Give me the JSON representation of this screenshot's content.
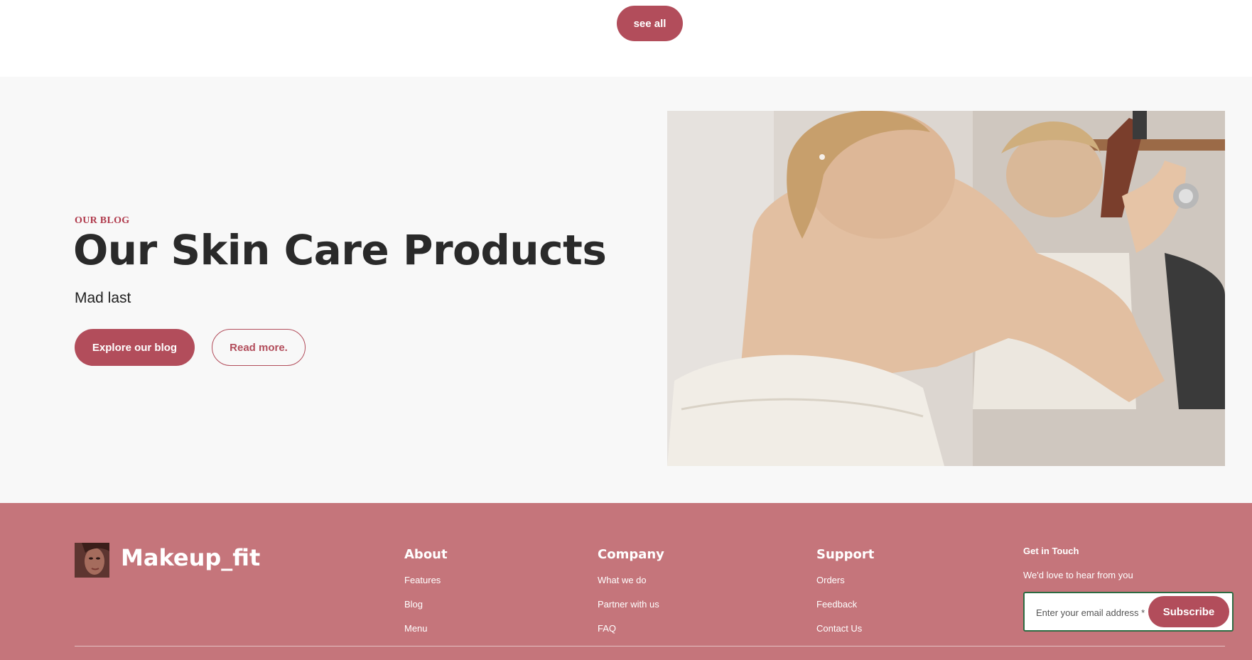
{
  "top": {
    "see_all_label": "see all"
  },
  "blog": {
    "eyebrow": "OUR BLOG",
    "title": "Our Skin Care Products",
    "subtitle": "Mad last",
    "primary_button": "Explore our blog",
    "secondary_button": "Read more."
  },
  "footer": {
    "brand": "Makeup_fit",
    "columns": [
      {
        "title": "About",
        "links": [
          "Features",
          "Blog",
          "Menu"
        ]
      },
      {
        "title": "Company",
        "links": [
          "What we do",
          "Partner with us",
          "FAQ"
        ]
      },
      {
        "title": "Support",
        "links": [
          "Orders",
          "Feedback",
          "Contact Us"
        ]
      }
    ],
    "contact": {
      "title": "Get in Touch",
      "subtitle": "We'd love to hear from you",
      "email_placeholder": "Enter your email address *",
      "subscribe_label": "Subscribe"
    }
  },
  "colors": {
    "accent": "#b24d5b",
    "footer_bg": "#c5757b",
    "section_bg": "#f8f8f8"
  }
}
